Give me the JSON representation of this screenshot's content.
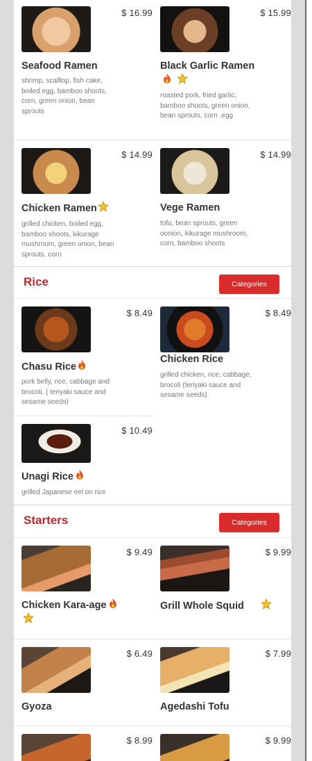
{
  "colors": {
    "accent": "#d92b2b",
    "section_title": "#c0282b",
    "desc_text": "#777777"
  },
  "sections": [
    {
      "title": "Rice",
      "button": "Categories"
    },
    {
      "title": "Starters",
      "button": "Categories"
    }
  ],
  "items": [
    {
      "name": "Seafood Ramen",
      "price": "$ 16.99",
      "icons": [],
      "desc": "shrimp, scalllop, fish cake, boiled egg, bamboo shoots, corn, green onion, bean sprouts"
    },
    {
      "name": "Black Garlic Ramen",
      "price": "$ 15.99",
      "icons": [
        "fire-icon",
        "star-icon"
      ],
      "desc": "roasted pork, fried garlic, bamboo shoots, green onion, bean sprouts, corn ,egg"
    },
    {
      "name": "Chicken Ramen",
      "price": "$ 14.99",
      "icons": [
        "star-icon"
      ],
      "desc": "grilled chicken, boiled egg, bamboo shoots, kikurage mushroom, green onion, bean sprouts, corn"
    },
    {
      "name": "Vege Ramen",
      "price": "$ 14.99",
      "icons": [],
      "desc": "tofu, bean sprouts, green oonion, kikurage mushroom, corn, bamboo shoots"
    },
    {
      "name": "Chasu Rice",
      "price": "$ 8.49",
      "icons": [
        "fire-icon"
      ],
      "desc": "pork belly, rice, cabbage and brocoli. ( teriyaki sauce and sesame seeds)"
    },
    {
      "name": "Chicken Rice",
      "price": "$ 8.49",
      "icons": [],
      "desc": "grilled chicken, rice, cabbage, brocoli (teriyaki sauce and sesame seeds)"
    },
    {
      "name": "Unagi Rice",
      "price": "$ 10.49",
      "icons": [
        "fire-icon"
      ],
      "desc": "grilled Japanese eel on rice"
    },
    {
      "name": "Chicken Kara-age",
      "price": "$ 9.49",
      "icons": [
        "fire-icon",
        "star-icon"
      ],
      "desc": ""
    },
    {
      "name": "Grill Whole Squid",
      "price": "$ 9.99",
      "icons": [
        "star-icon"
      ],
      "desc": ""
    },
    {
      "name": "Gyoza",
      "price": "$ 6.49",
      "icons": [],
      "desc": ""
    },
    {
      "name": "Agedashi Tofu",
      "price": "$ 7.99",
      "icons": [],
      "desc": ""
    },
    {
      "name": "",
      "price": "$ 8.99",
      "icons": [],
      "desc": ""
    },
    {
      "name": "",
      "price": "$ 9.99",
      "icons": [],
      "desc": ""
    }
  ]
}
